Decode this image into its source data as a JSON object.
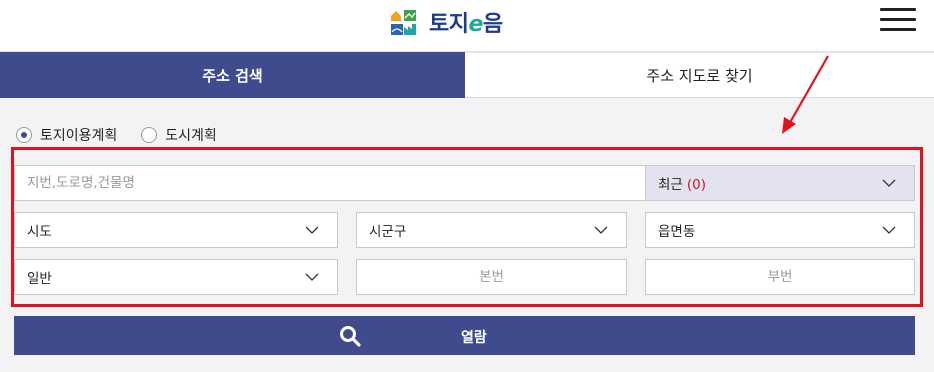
{
  "header": {
    "logo_text_a": "토지",
    "logo_text_e": "e",
    "logo_text_b": "음",
    "menu_icon": "hamburger-menu-icon"
  },
  "tabs": [
    {
      "label": "주소 검색",
      "active": true
    },
    {
      "label": "주소 지도로 찾기",
      "active": false
    }
  ],
  "radios": [
    {
      "label": "토지이용계획",
      "checked": true
    },
    {
      "label": "도시계획",
      "checked": false
    }
  ],
  "search": {
    "address_placeholder": "지번,도로명,건물명",
    "recent_label": "최근",
    "recent_count": "(0)"
  },
  "selects": {
    "sido": "시도",
    "sigungu": "시군구",
    "eupmyeondong": "읍면동",
    "land_type": "일반"
  },
  "inputs": {
    "main_number_placeholder": "본번",
    "sub_number_placeholder": "부번"
  },
  "view_button": {
    "label": "열람",
    "icon": "search-icon"
  },
  "colors": {
    "primary": "#404b8e",
    "annotation_red": "#e0151c",
    "recent_count": "#d0141b",
    "logo_blue": "#1f3c87",
    "logo_teal": "#1fa6a0"
  }
}
